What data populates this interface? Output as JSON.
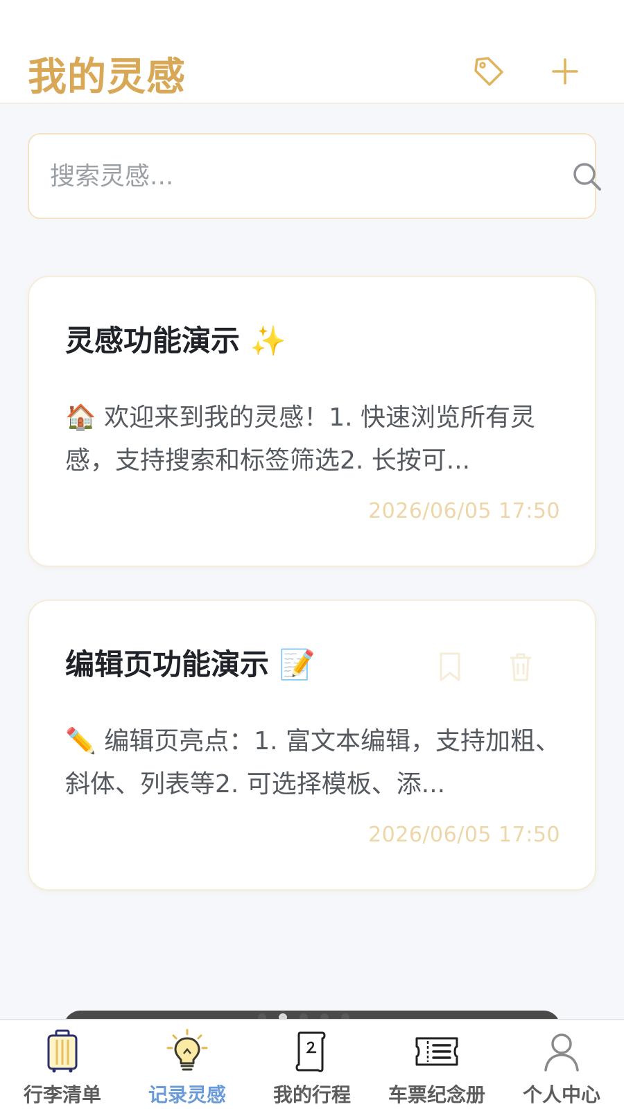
{
  "header": {
    "title": "我的灵感",
    "icons": [
      "tag-icon",
      "plus-icon"
    ]
  },
  "search": {
    "placeholder": "搜索灵感...",
    "value": ""
  },
  "cards": [
    {
      "title": "灵感功能演示 ✨",
      "body": "🏠 欢迎来到我的灵感！1. 快速浏览所有灵感，支持搜索和标签筛选2. 长按可...",
      "date": "2026/06/05 17:50"
    },
    {
      "title": "编辑页功能演示 📝",
      "body": "✏️ 编辑页亮点：1. 富文本编辑，支持加粗、斜体、列表等2. 可选择模板、添...",
      "date": "2026/06/05 17:50",
      "actions": [
        "bookmark-icon",
        "trash-icon"
      ]
    }
  ],
  "tabbar": {
    "active": "记录灵感",
    "tabs": [
      {
        "label": "行李清单",
        "icon": "luggage-icon"
      },
      {
        "label": "记录灵感",
        "icon": "lightbulb-icon"
      },
      {
        "label": "我的行程",
        "icon": "scroll-icon"
      },
      {
        "label": "车票纪念册",
        "icon": "ticket-icon"
      },
      {
        "label": "个人中心",
        "icon": "user-icon"
      }
    ]
  },
  "colors": {
    "accent": "#d9a856",
    "background": "#f5f7fa",
    "tab_active": "#6a9ad8",
    "date": "#edd6a8"
  }
}
